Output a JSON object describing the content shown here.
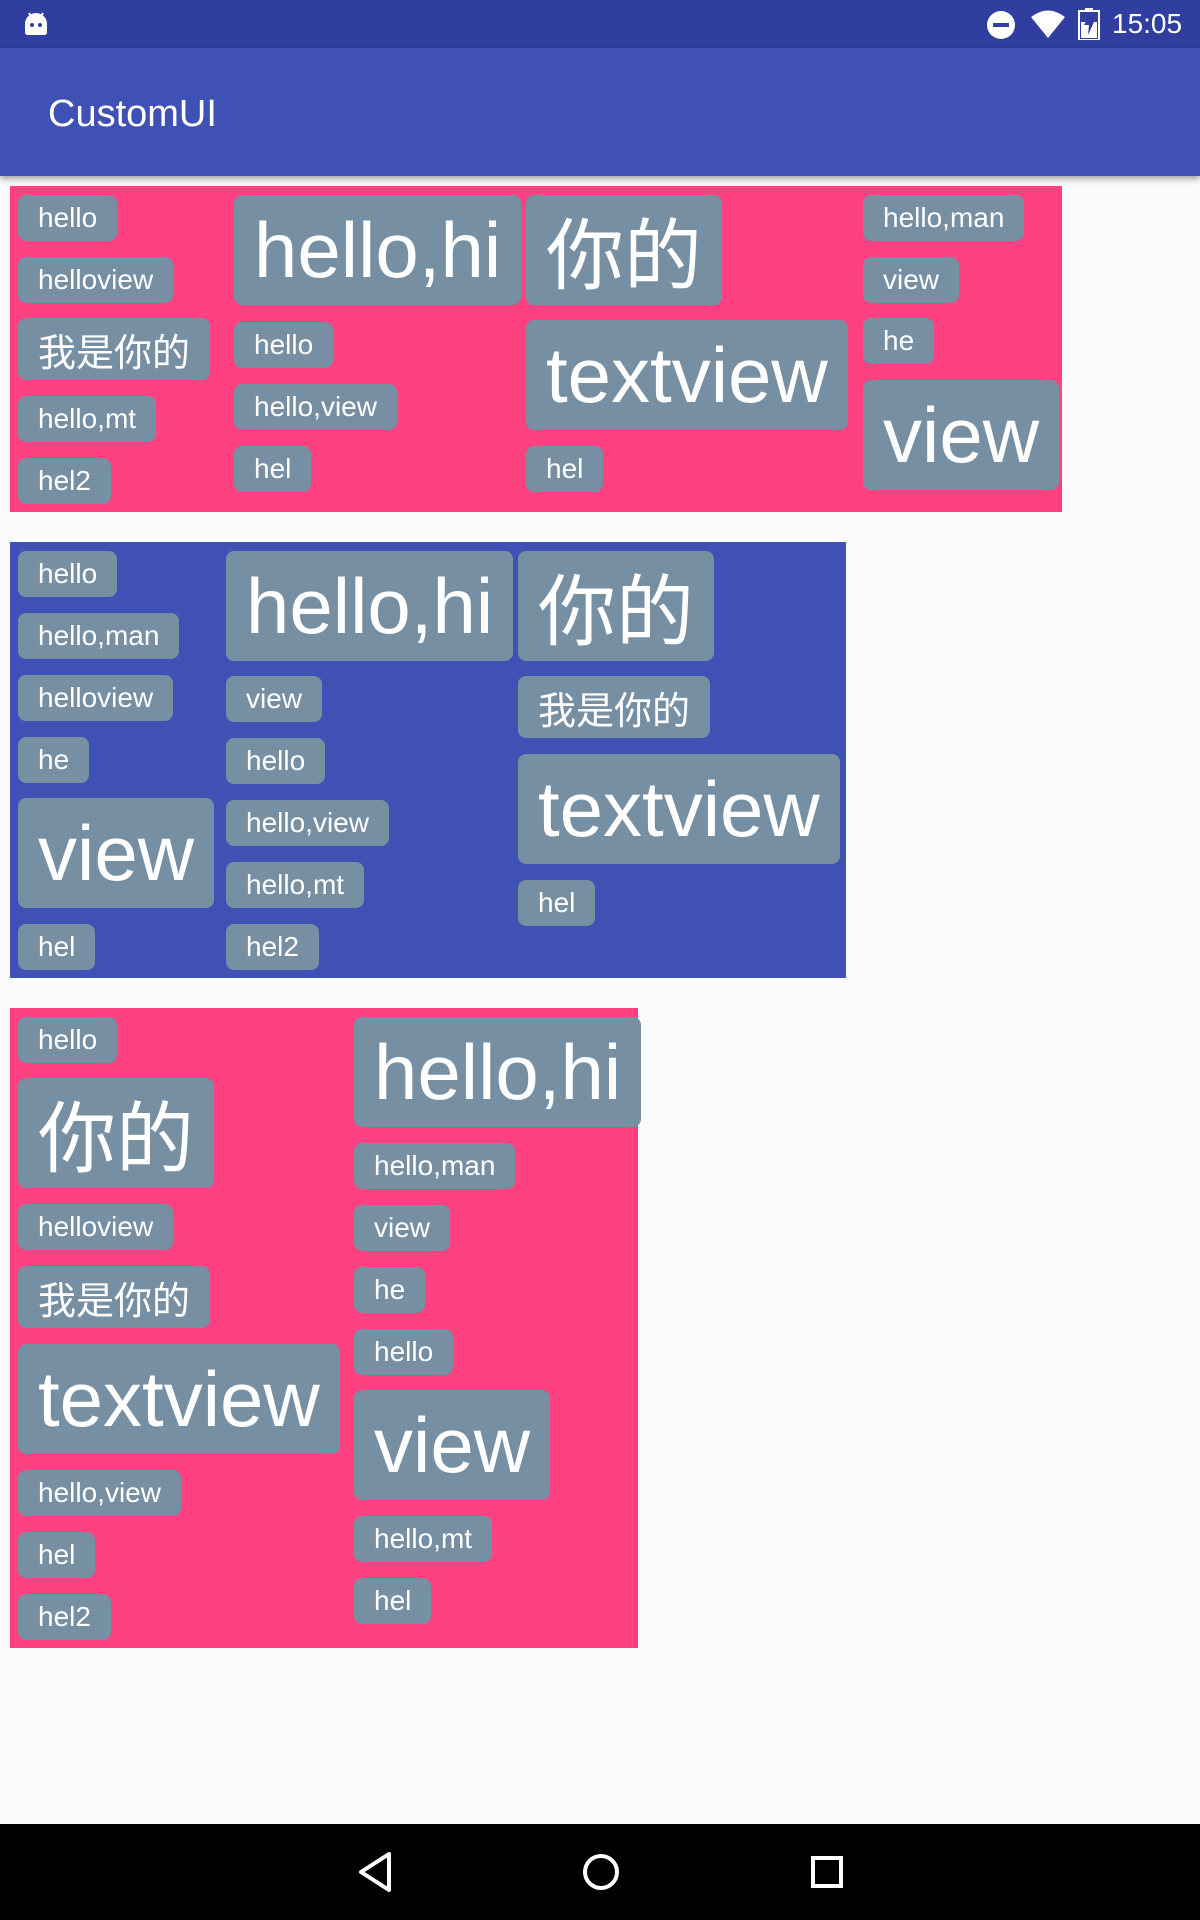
{
  "status_bar": {
    "time": "15:05",
    "icons": [
      "android-debug-icon",
      "do-not-disturb-icon",
      "wifi-icon",
      "battery-icon"
    ]
  },
  "app_bar": {
    "title": "CustomUI"
  },
  "colors": {
    "status_bar": "#303f9f",
    "app_bar": "#3f51b5",
    "pink_box": "#ff4081",
    "blue_box": "#3f51b5",
    "chip": "#778fa3",
    "background": "#fafafa"
  },
  "box1": {
    "chips": [
      "hello",
      "helloview",
      "我是你的",
      "hello,mt",
      "hel2",
      "hello,hi",
      "hello",
      "hello,view",
      "hel",
      "你的",
      "textview",
      "hel",
      "hello,man",
      "view",
      "he",
      "view"
    ]
  },
  "box2": {
    "chips": [
      "hello",
      "hello,man",
      "helloview",
      "he",
      "view",
      "hel",
      "hello,hi",
      "view",
      "hello",
      "hello,view",
      "hello,mt",
      "hel2",
      "你的",
      "我是你的",
      "textview",
      "hel"
    ]
  },
  "box3": {
    "chips": [
      "hello",
      "你的",
      "helloview",
      "我是你的",
      "textview",
      "hello,view",
      "hel",
      "hel2",
      "hello,hi",
      "hello,man",
      "view",
      "he",
      "hello",
      "view",
      "hello,mt",
      "hel"
    ]
  },
  "nav_bar": {
    "icons": [
      "back-icon",
      "home-icon",
      "recents-icon"
    ]
  }
}
